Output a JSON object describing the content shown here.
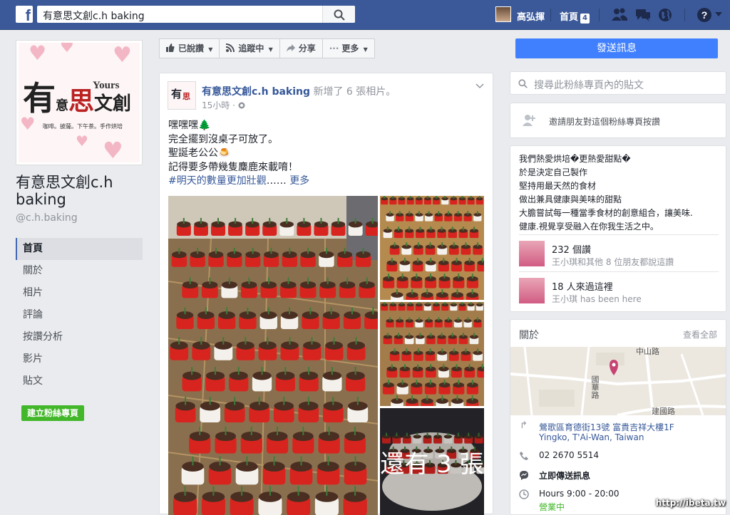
{
  "topbar": {
    "logo": "f",
    "search_value": "有意思文創c.h baking",
    "user_name": "高弘揮",
    "home_label": "首頁",
    "home_count": "4"
  },
  "left": {
    "cover_title_main": "有",
    "cover_title_mid1": "意",
    "cover_title_mid2": "思",
    "cover_title_end": "文創",
    "cover_yours": "Yours",
    "cover_tagline": "咖啡。披薩。下午茶。手作烘培",
    "page_name": "有意思文創c.h baking",
    "page_handle": "@c.h.baking",
    "nav": [
      {
        "label": "首頁",
        "active": true
      },
      {
        "label": "關於"
      },
      {
        "label": "相片"
      },
      {
        "label": "評論"
      },
      {
        "label": "按讚分析"
      },
      {
        "label": "影片"
      },
      {
        "label": "貼文"
      }
    ],
    "create_page_label": "建立粉絲專頁"
  },
  "actions": {
    "liked": "已說讚",
    "following": "追蹤中",
    "share": "分享",
    "more": "更多",
    "send_message": "發送訊息"
  },
  "post": {
    "author": "有意思文創c.h baking",
    "added_text": " 新增了 6 張相片。",
    "time": "15小時 · ",
    "lines": [
      "嘿嘿嘿🌲",
      "完全擺到沒桌子可放了。",
      "聖誕老公公🍮",
      "記得要多帶幾隻麋鹿來載唷！"
    ],
    "hashtag": "#明天的數量更加壯觀",
    "ellipsis": "…… ",
    "see_more": "更多",
    "more_photos": "還有 3 張"
  },
  "right": {
    "search_placeholder": "搜尋此粉絲專頁內的貼文",
    "invite_text": "邀請朋友對這個粉絲專頁按讚",
    "about_lines": [
      "我們熱愛烘培�更熱愛甜點�",
      "於是決定自己製作",
      "堅持用最天然的食材",
      "做出兼具健康與美味的甜點",
      "大膽嘗試每一種當季食材的創意組合，讓美味.",
      "健康.視覺享受融入在你我生活之中。"
    ],
    "likes_count": "232 個讚",
    "likes_sub_name": "王小琪",
    "likes_sub_rest": "和其他 8 位朋友都說這讚",
    "visits": "18 人來過這裡",
    "visits_sub_name": "王小琪",
    "visits_sub_rest": " has been here",
    "about_header": "關於",
    "see_all": "查看全部",
    "map_labels": {
      "road1": "中山路",
      "road2": "國華路",
      "road3": "建國路"
    },
    "address_1": "鶯歌區育德街13號 富貴吉祥大樓1F",
    "address_2": "Yingko, T'Ai-Wan, Taiwan",
    "phone": "02 2670 5514",
    "message_now": "立即傳送訊息",
    "hours": "Hours 9:00 - 20:00",
    "open_now": "營業中"
  },
  "watermark": "http://ibeta.tw",
  "colors": {
    "fb_blue": "#3b5998",
    "link": "#365899",
    "send": "#4080ff",
    "create": "#42b72a"
  }
}
